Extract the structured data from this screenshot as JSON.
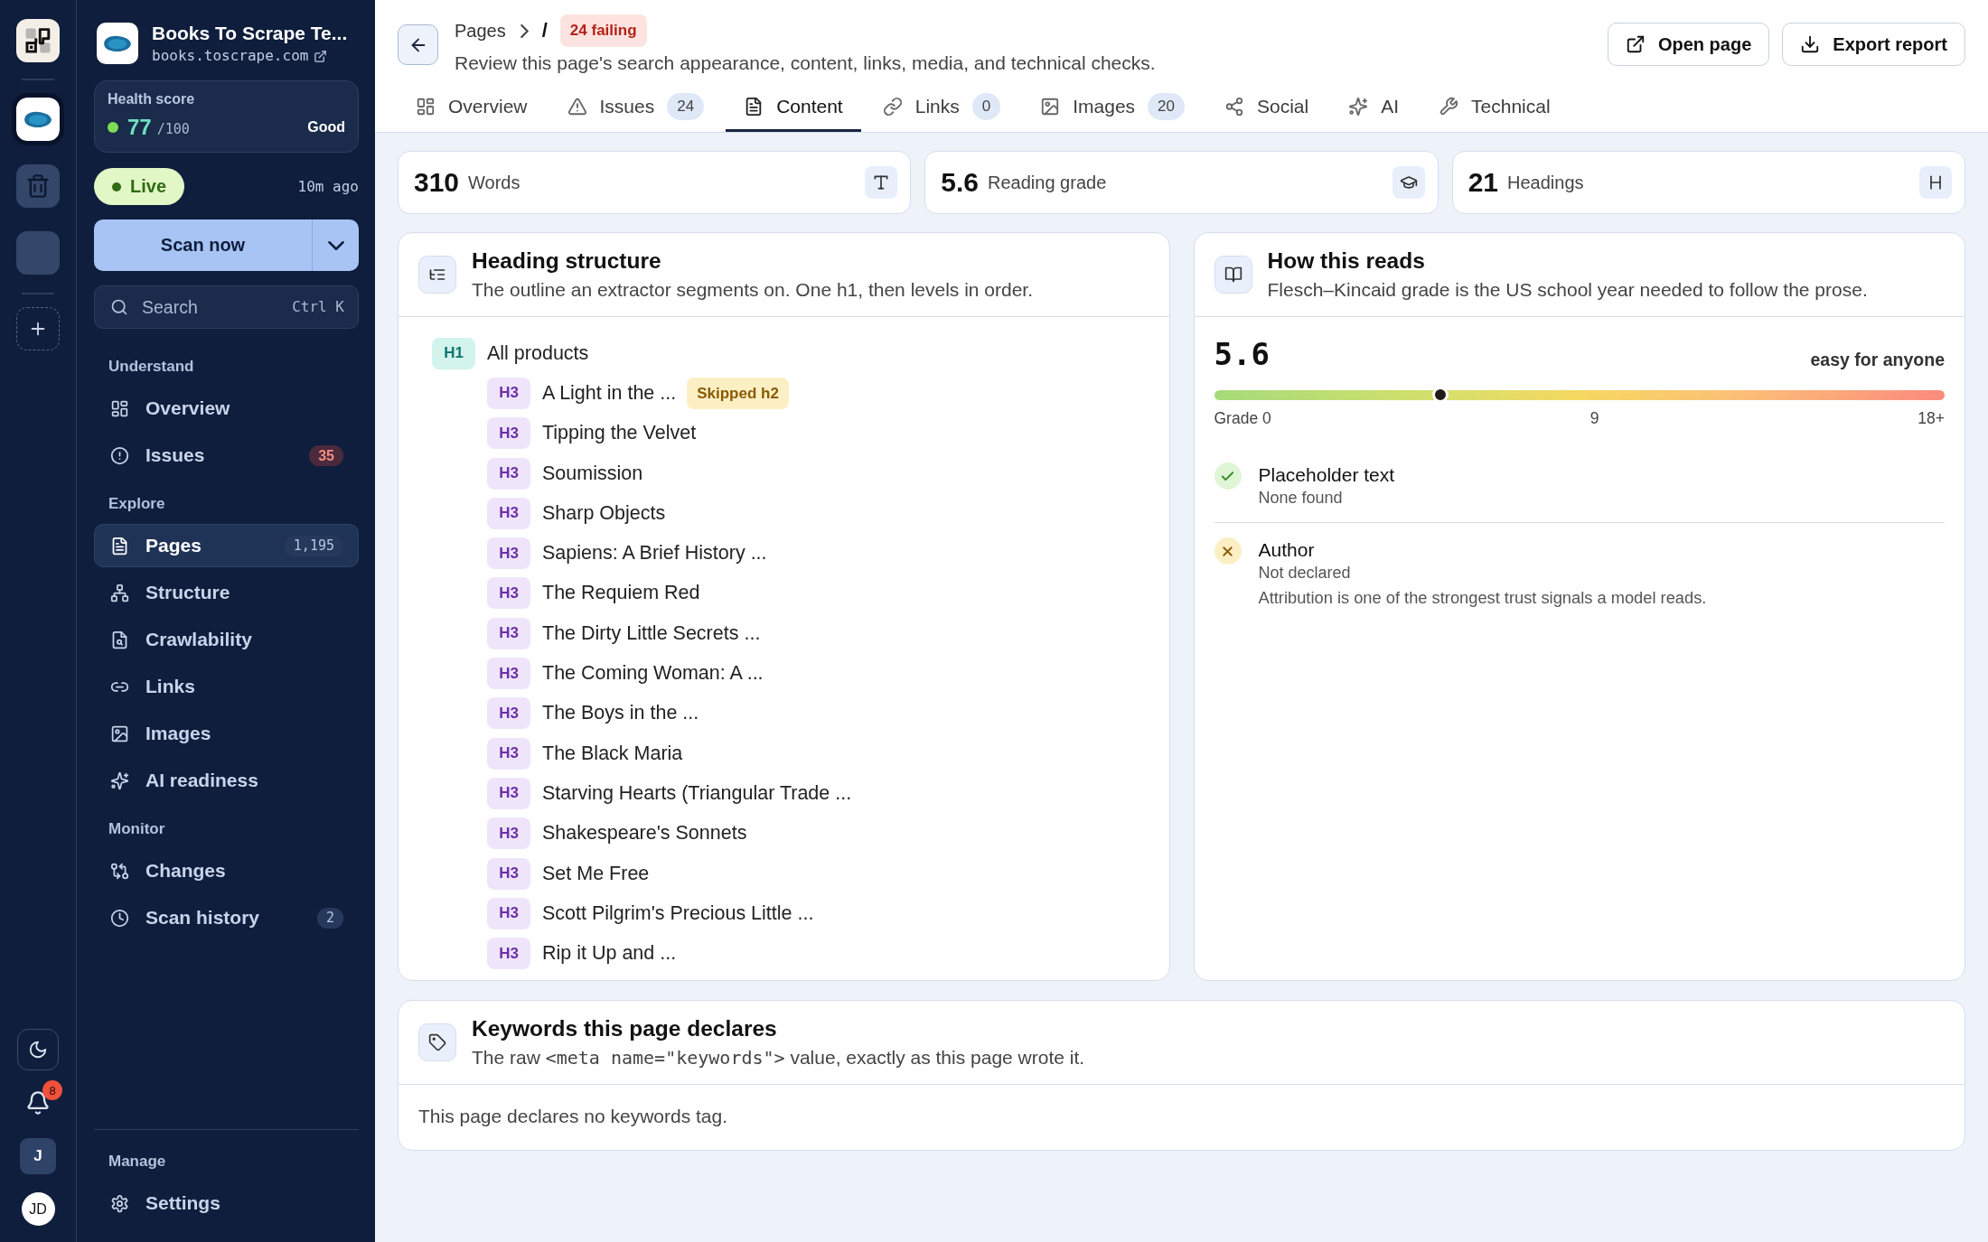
{
  "rail": {
    "sites": [
      {
        "selected": true
      },
      {
        "selected": false
      },
      {
        "selected": false
      }
    ],
    "notifications": "8",
    "workspace": "J",
    "avatar": "JD"
  },
  "site": {
    "title": "Books To Scrape Te...",
    "domain": "books.toscrape.com"
  },
  "health": {
    "label": "Health score",
    "score": "77",
    "max": "/100",
    "rating": "Good"
  },
  "status": {
    "label": "Live",
    "updated": "10m ago"
  },
  "scan": {
    "label": "Scan now"
  },
  "search": {
    "placeholder": "Search",
    "shortcut": "Ctrl K"
  },
  "nav": [
    {
      "heading": "Understand",
      "items": [
        {
          "label": "Overview",
          "selected": false
        },
        {
          "label": "Issues",
          "badge": "35",
          "badge_alert": true,
          "selected": false
        }
      ]
    },
    {
      "heading": "Explore",
      "items": [
        {
          "label": "Pages",
          "badge": "1,195",
          "badge_alert": false,
          "selected": true
        },
        {
          "label": "Structure",
          "selected": false
        },
        {
          "label": "Crawlability",
          "selected": false
        },
        {
          "label": "Links",
          "selected": false
        },
        {
          "label": "Images",
          "selected": false
        },
        {
          "label": "AI readiness",
          "selected": false
        }
      ]
    },
    {
      "heading": "Monitor",
      "items": [
        {
          "label": "Changes",
          "selected": false
        },
        {
          "label": "Scan history",
          "badge": "2",
          "badge_alert": false,
          "selected": false
        }
      ]
    }
  ],
  "footer_nav": {
    "heading": "Manage",
    "items": [
      {
        "label": "Settings",
        "selected": false
      }
    ]
  },
  "header": {
    "breadcrumb": "Pages",
    "path": "/",
    "failing": "24 failing",
    "subtitle": "Review this page's search appearance, content, links, media, and technical checks.",
    "actions": [
      {
        "label": "Open page"
      },
      {
        "label": "Export report"
      }
    ]
  },
  "tabs": [
    {
      "label": "Overview",
      "selected": false
    },
    {
      "label": "Issues",
      "count": "24",
      "selected": false
    },
    {
      "label": "Content",
      "selected": true
    },
    {
      "label": "Links",
      "count": "0",
      "selected": false
    },
    {
      "label": "Images",
      "count": "20",
      "selected": false
    },
    {
      "label": "Social",
      "selected": false
    },
    {
      "label": "AI",
      "selected": false
    },
    {
      "label": "Technical",
      "selected": false
    }
  ],
  "stats": [
    {
      "value": "310",
      "label": "Words"
    },
    {
      "value": "5.6",
      "label": "Reading grade"
    },
    {
      "value": "21",
      "label": "Headings"
    }
  ],
  "headings": {
    "title": "Heading structure",
    "subtitle": "The outline an extractor segments on. One h1, then levels in order.",
    "tree": [
      {
        "level": "H1",
        "text": "All products",
        "children": [
          {
            "level": "H3",
            "text": "A Light in the ...",
            "flag": "Skipped h2"
          },
          {
            "level": "H3",
            "text": "Tipping the Velvet"
          },
          {
            "level": "H3",
            "text": "Soumission"
          },
          {
            "level": "H3",
            "text": "Sharp Objects"
          },
          {
            "level": "H3",
            "text": "Sapiens: A Brief History ..."
          },
          {
            "level": "H3",
            "text": "The Requiem Red"
          },
          {
            "level": "H3",
            "text": "The Dirty Little Secrets ..."
          },
          {
            "level": "H3",
            "text": "The Coming Woman: A ..."
          },
          {
            "level": "H3",
            "text": "The Boys in the ..."
          },
          {
            "level": "H3",
            "text": "The Black Maria"
          },
          {
            "level": "H3",
            "text": "Starving Hearts (Triangular Trade ..."
          },
          {
            "level": "H3",
            "text": "Shakespeare's Sonnets"
          },
          {
            "level": "H3",
            "text": "Set Me Free"
          },
          {
            "level": "H3",
            "text": "Scott Pilgrim's Precious Little ..."
          },
          {
            "level": "H3",
            "text": "Rip it Up and ..."
          }
        ]
      }
    ]
  },
  "reads": {
    "title": "How this reads",
    "subtitle": "Flesch–Kincaid grade is the US school year needed to follow the prose.",
    "grade": "5.6",
    "verdict": "easy for anyone",
    "level": 0.31,
    "scale": [
      "Grade 0",
      "9",
      "18+"
    ],
    "checks": [
      {
        "label": "Placeholder text",
        "value": "None found",
        "passed": true
      },
      {
        "label": "Author",
        "value": "Not declared",
        "passed": false,
        "note": "Attribution is one of the strongest trust signals a model reads."
      }
    ]
  },
  "keywords": {
    "title": "Keywords this page declares",
    "subtitle": [
      {
        "kind": "text",
        "text": "The raw "
      },
      {
        "kind": "code",
        "text": "<meta name=\"keywords\">"
      },
      {
        "kind": "text",
        "text": " value, exactly as this page wrote it."
      }
    ],
    "empty": "This page declares no keywords tag."
  }
}
